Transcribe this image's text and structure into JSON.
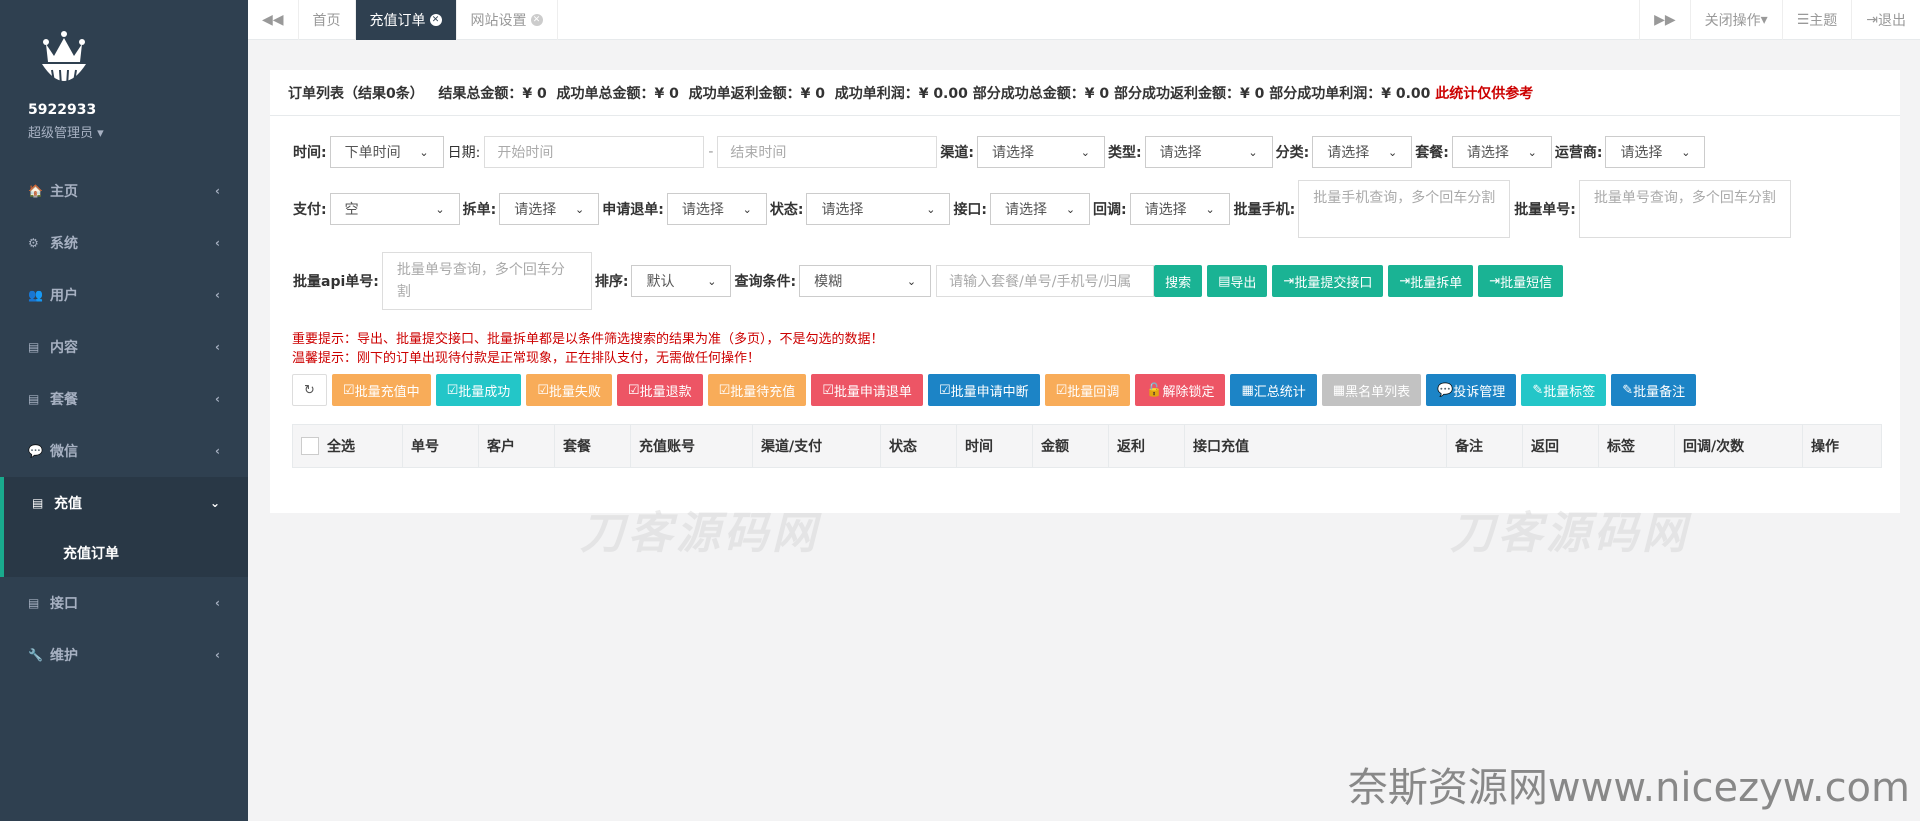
{
  "sidebar": {
    "user": "5922933",
    "role": "超级管理员",
    "items": [
      {
        "label": "主页",
        "icon": "home-icon",
        "glyph": "🏠"
      },
      {
        "label": "系统",
        "icon": "cogs-icon",
        "glyph": "⚙"
      },
      {
        "label": "用户",
        "icon": "users-icon",
        "glyph": "👥"
      },
      {
        "label": "内容",
        "icon": "file-icon",
        "glyph": "▤"
      },
      {
        "label": "套餐",
        "icon": "file-text-icon",
        "glyph": "▤"
      },
      {
        "label": "微信",
        "icon": "wechat-icon",
        "glyph": "💬"
      },
      {
        "label": "充值",
        "icon": "file-icon",
        "glyph": "▤"
      },
      {
        "label": "接口",
        "icon": "file-icon",
        "glyph": "▤"
      },
      {
        "label": "维护",
        "icon": "wrench-icon",
        "glyph": "🔧"
      }
    ],
    "sub_item": "充值订单"
  },
  "tabs": {
    "items": [
      "首页",
      "充值订单",
      "网站设置"
    ],
    "close_ops": "关闭操作",
    "theme": "主题",
    "logout": "退出"
  },
  "summary": {
    "title": "订单列表（结果0条）",
    "s1": "结果总金额：¥ 0",
    "s2": "成功单总金额：¥ 0",
    "s3": "成功单返利金额：¥ 0",
    "s4": "成功单利润：¥ 0.00",
    "s5": "部分成功总金额：¥ 0",
    "s6": "部分成功返利金额：¥ 0",
    "s7": "部分成功单利润：¥ 0.00",
    "note": "此统计仅供参考"
  },
  "filters": {
    "time_label": "时间:",
    "time_value": "下单时间",
    "date_label": "日期:",
    "start_ph": "开始时间",
    "sep": "-",
    "end_ph": "结束时间",
    "channel_label": "渠道:",
    "type_label": "类型:",
    "cat_label": "分类:",
    "pkg_label": "套餐:",
    "op_label": "运营商:",
    "please": "请选择",
    "pay_label": "支付:",
    "pay_value": "空",
    "split_label": "拆单:",
    "refund_label": "申请退单:",
    "status_label": "状态:",
    "api_label": "接口:",
    "callback_label": "回调:",
    "bulk_phone_label": "批量手机:",
    "bulk_phone_ph": "批量手机查询，多个回车分割",
    "bulk_order_label": "批量单号:",
    "bulk_order_ph": "批量单号查询，多个回车分割",
    "bulk_api_label": "批量api单号:",
    "bulk_api_ph": "批量单号查询，多个回车分割",
    "sort_label": "排序:",
    "sort_value": "默认",
    "cond_label": "查询条件:",
    "cond_value": "模糊",
    "search_ph": "请输入套餐/单号/手机号/归属"
  },
  "buttons": {
    "search": "搜索",
    "export": "导出",
    "bulk_submit": "批量提交接口",
    "bulk_split": "批量拆单",
    "bulk_sms": "批量短信"
  },
  "warnings": {
    "w1": "重要提示：导出、批量提交接口、批量拆单都是以条件筛选搜索的结果为准（多页），不是勾选的数据！",
    "w2": "温馨提示：刚下的订单出现待付款是正常现象，正在排队支付，无需做任何操作！"
  },
  "actions": [
    "批量充值中",
    "批量成功",
    "批量失败",
    "批量退款",
    "批量待充值",
    "批量申请退单",
    "批量申请中断",
    "批量回调",
    "解除锁定",
    "汇总统计",
    "黑名单列表",
    "投诉管理",
    "批量标签",
    "批量备注"
  ],
  "table": {
    "headers": [
      "全选",
      "单号",
      "客户",
      "套餐",
      "充值账号",
      "渠道/支付",
      "状态",
      "时间",
      "金额",
      "返利",
      "接口充值",
      "备注",
      "返回",
      "标签",
      "回调/次数",
      "操作"
    ]
  },
  "watermark": {
    "w1": "刀客源码网",
    "w2": "刀客源码网",
    "footer": "奈斯资源网www.nicezyw.com"
  },
  "colors": {
    "sidebar": "#2f4050",
    "primary": "#1ab394"
  }
}
